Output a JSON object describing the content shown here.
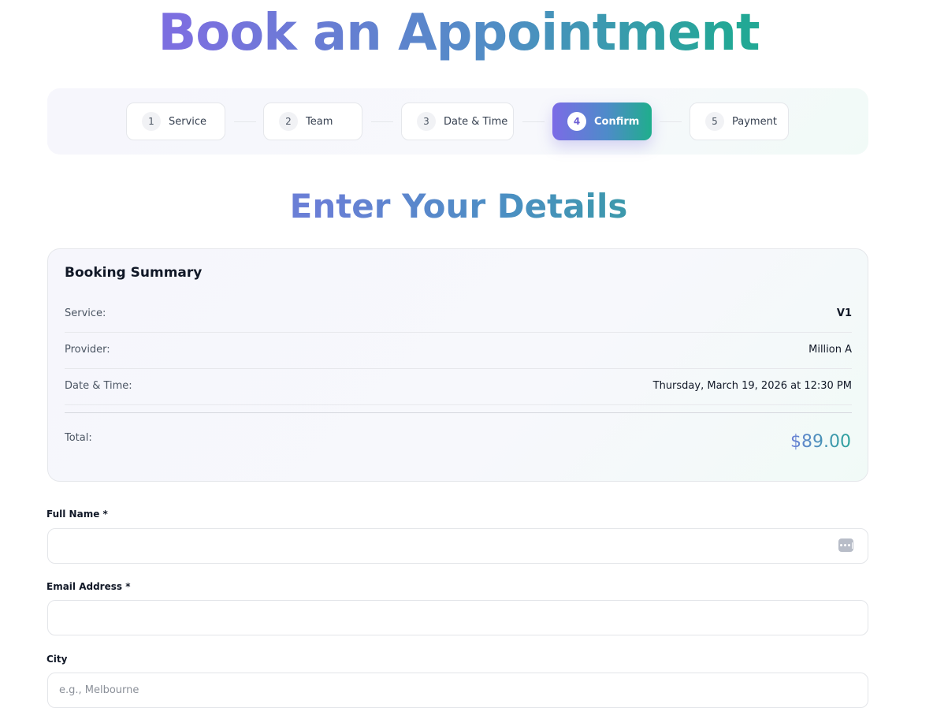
{
  "page": {
    "title": "Book an Appointment"
  },
  "stepper": {
    "steps": [
      {
        "number": "1",
        "label": "Service",
        "state": "done"
      },
      {
        "number": "2",
        "label": "Team",
        "state": "done"
      },
      {
        "number": "3",
        "label": "Date & Time",
        "state": "done"
      },
      {
        "number": "4",
        "label": "Confirm",
        "state": "active"
      },
      {
        "number": "5",
        "label": "Payment",
        "state": "upcoming"
      }
    ]
  },
  "section": {
    "title": "Enter Your Details"
  },
  "summary": {
    "title": "Booking Summary",
    "rows": [
      {
        "label": "Service:",
        "value": "V1"
      },
      {
        "label": "Provider:",
        "value": "Million A"
      },
      {
        "label": "Date & Time:",
        "value": "Thursday, March 19, 2026 at 12:30 PM"
      }
    ],
    "total_label": "Total:",
    "total_value": "$89.00"
  },
  "form": {
    "full_name": {
      "label": "Full Name *",
      "value": "",
      "placeholder": ""
    },
    "email": {
      "label": "Email Address *",
      "value": "",
      "placeholder": ""
    },
    "city": {
      "label": "City",
      "value": "",
      "placeholder": "e.g., Melbourne"
    },
    "autofill_icon": "password-manager-icon"
  },
  "colors": {
    "accent_purple": "#7b6be6",
    "accent_blue": "#4e8bc9",
    "accent_teal": "#1fae8c"
  }
}
